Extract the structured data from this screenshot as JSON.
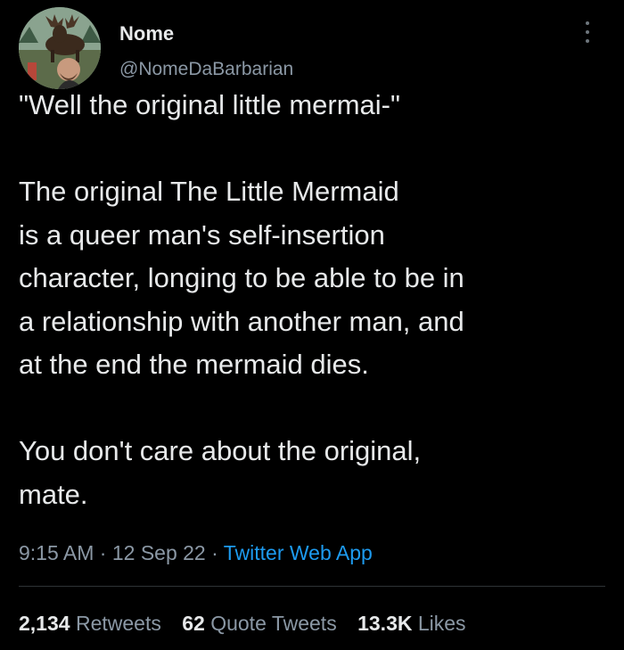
{
  "author": {
    "display_name": "Nome",
    "handle": "@NomeDaBarbarian",
    "avatar_icon": "moose-and-man-avatar"
  },
  "tweet": {
    "text": "\"Well the original little mermai-\"\n\nThe original The Little Mermaid\nis a queer man's self-insertion\ncharacter, longing to be able to be in\na relationship with another man, and\nat the end the mermaid dies.\n\nYou don't care about the original,\nmate."
  },
  "meta": {
    "time": "9:15 AM",
    "separator": " · ",
    "date": "12 Sep 22",
    "source": "Twitter Web App"
  },
  "stats": {
    "retweets_count": "2,134",
    "retweets_label": "Retweets",
    "quote_count": "62",
    "quote_label": "Quote Tweets",
    "likes_count": "13.3K",
    "likes_label": "Likes"
  },
  "colors": {
    "background": "#000000",
    "text": "#e7e9ea",
    "secondary": "#8b98a5",
    "link": "#1d9bf0",
    "divider": "#2f3336"
  }
}
